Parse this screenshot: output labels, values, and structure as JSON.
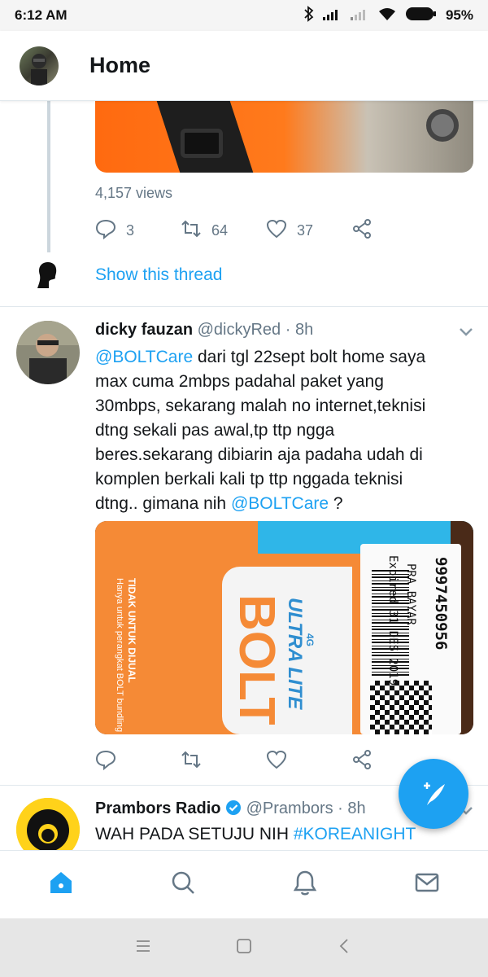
{
  "status_bar": {
    "time": "6:12 AM",
    "battery": "95%"
  },
  "header": {
    "title": "Home"
  },
  "previous_tweet": {
    "views": "4,157 views",
    "reply_count": "3",
    "retweet_count": "64",
    "like_count": "37",
    "show_thread": "Show this thread"
  },
  "tweet": {
    "name": "dicky fauzan",
    "handle": "@dickyRed · 8h",
    "lines": [
      [
        {
          "t": "@BOLTCare",
          "link": true
        },
        {
          "t": " dari tgl 22sept bolt home saya",
          "link": false
        }
      ],
      [
        {
          "t": "max cuma 2mbps padahal paket yang",
          "link": false
        }
      ],
      [
        {
          "t": "30mbps, sekarang malah no internet,teknisi",
          "link": false
        }
      ],
      [
        {
          "t": "dtng sekali pas awal,tp ttp ngga",
          "link": false
        }
      ],
      [
        {
          "t": "beres.sekarang dibiarin aja padaha udah di",
          "link": false
        }
      ],
      [
        {
          "t": "komplen berkali kali tp ttp nggada teknisi",
          "link": false
        }
      ],
      [
        {
          "t": "dtng.. gimana nih ",
          "link": false
        },
        {
          "t": "@BOLTCare",
          "link": true
        },
        {
          "t": " ?",
          "link": false
        }
      ]
    ],
    "card": {
      "brand": "BOLT",
      "product": "ULTRA LITE",
      "badge": "4G",
      "number": "9997450956",
      "plan": "PRA BAYAR",
      "expiry": "Expired 31 DES 2019",
      "notice": "TIDAK UNTUK DIJUAL",
      "notice_sub": "Hanya untuk perangkat BOLT bundling"
    }
  },
  "next_tweet": {
    "name": "Prambors Radio",
    "handle": "@Prambors · 8h",
    "text": "WAH PADA SETUJU NIH ",
    "hashtag": "#KOREANIGHT"
  },
  "colors": {
    "accent": "#1da1f2",
    "text": "#14171a",
    "muted": "#657786"
  }
}
